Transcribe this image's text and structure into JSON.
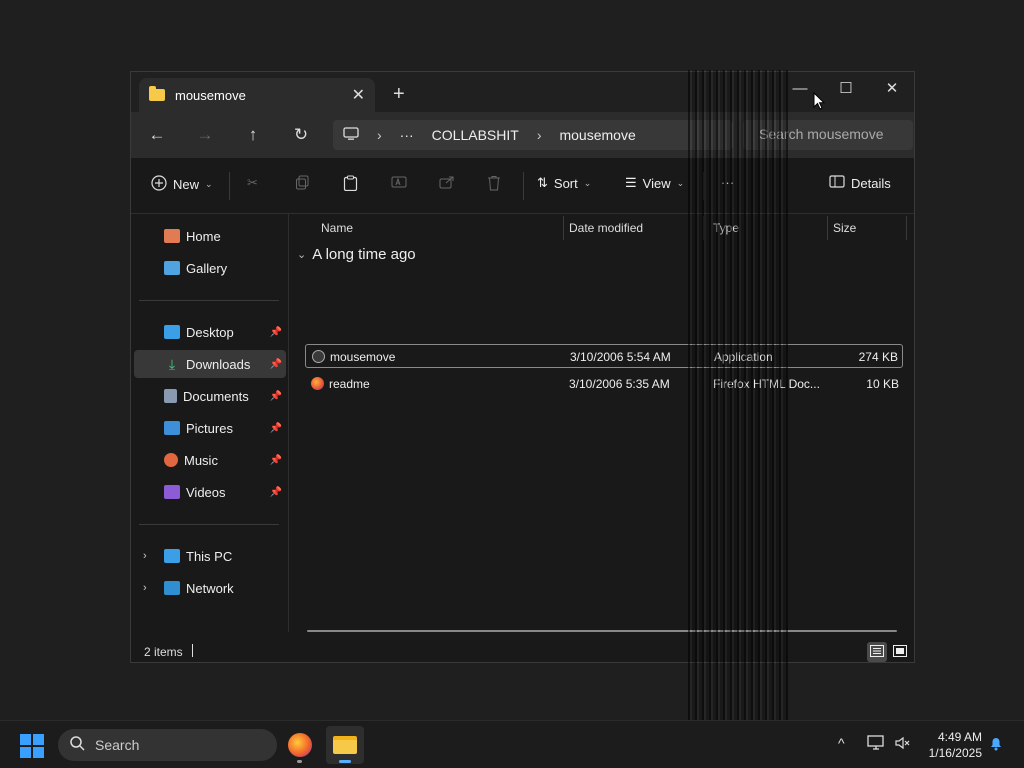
{
  "window": {
    "tab_title": "mousemove",
    "new_tab_label": "+",
    "minimize_glyph": "—",
    "maximize_glyph": "☐",
    "close_glyph": "✕",
    "tab_close_glyph": "✕"
  },
  "address": {
    "back_glyph": "←",
    "forward_glyph": "→",
    "up_glyph": "↑",
    "refresh_glyph": "↻",
    "crumbs": [
      "COLLABSHIT",
      "mousemove"
    ],
    "more_glyph": "···",
    "sep_glyph": "›",
    "search_placeholder": "Search mousemove"
  },
  "toolbar": {
    "new_label": "New",
    "sort_label": "Sort",
    "view_label": "View",
    "more_label": "···",
    "details_label": "Details"
  },
  "sidebar": {
    "home": "Home",
    "gallery": "Gallery",
    "desktop": "Desktop",
    "downloads": "Downloads",
    "documents": "Documents",
    "pictures": "Pictures",
    "music": "Music",
    "videos": "Videos",
    "this_pc": "This PC",
    "network": "Network",
    "expand_glyph": "›"
  },
  "files": {
    "columns": {
      "name": "Name",
      "date": "Date modified",
      "type": "Type",
      "size": "Size"
    },
    "group": "A long time ago",
    "rows": [
      {
        "name": "mousemove",
        "date": "3/10/2006 5:54 AM",
        "type": "Application",
        "size": "274 KB",
        "icon": "app-icon"
      },
      {
        "name": "readme",
        "date": "3/10/2006 5:35 AM",
        "type": "Firefox HTML Doc...",
        "size": "10 KB",
        "icon": "firefox-html-icon"
      }
    ]
  },
  "status": {
    "items": "2 items"
  },
  "taskbar": {
    "search": "Search",
    "time": "4:49 AM",
    "date": "1/16/2025",
    "chevron_glyph": "^"
  },
  "colors": {
    "accent": "#3aa0ff",
    "folder": "#f7c948"
  }
}
